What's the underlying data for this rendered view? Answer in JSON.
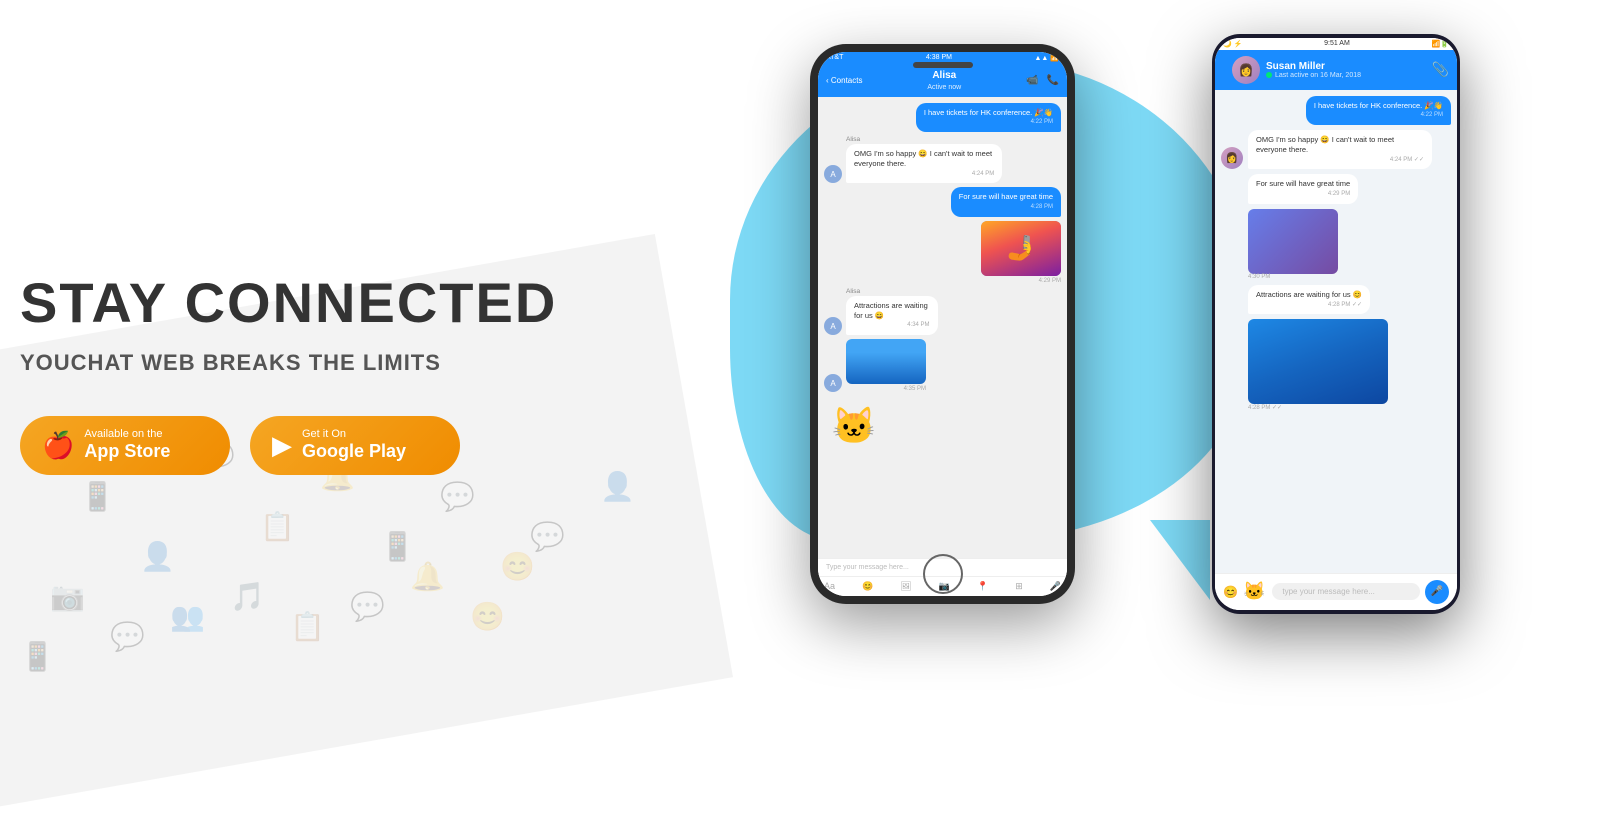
{
  "page": {
    "bg_color": "#ffffff"
  },
  "left": {
    "title": "STAY CONNECTED",
    "subtitle": "YOUCHAT WEB BREAKS THE LIMITS",
    "app_store": {
      "small": "Available on the",
      "big": "App Store",
      "icon": "🍎"
    },
    "google_play": {
      "small": "Get it On",
      "big": "Google Play",
      "icon": "▶"
    }
  },
  "phone1": {
    "carrier": "AT&T",
    "time": "4:38 PM",
    "contact_back": "Contacts",
    "chat_name": "Alisa",
    "chat_status": "Active now",
    "messages": [
      {
        "type": "sent",
        "text": "I have tickets for HK conference. 🎉👋",
        "time": "4:22 PM"
      },
      {
        "type": "received",
        "sender": "Alisa",
        "text": "OMG I'm so happy 😄 I can't wait to meet everyone there.",
        "time": "4:24 PM"
      },
      {
        "type": "sent",
        "text": "For sure will have great time",
        "time": "4:28 PM"
      },
      {
        "type": "sent-image",
        "time": "4:29 PM"
      },
      {
        "type": "received",
        "sender": "Alisa",
        "text": "Attractions are waiting for us 😄",
        "time": "4:34 PM"
      },
      {
        "type": "received-image",
        "time": "4:35 PM"
      },
      {
        "type": "sticker"
      }
    ],
    "input_placeholder": "Type your message here..."
  },
  "phone2": {
    "time": "9:51 AM",
    "chat_name": "Susan Miller",
    "chat_status": "Last active on 16 Mar, 2018",
    "messages": [
      {
        "type": "sent",
        "text": "I have tickets for HK conference. 🎉👋",
        "time": "4:22 PM"
      },
      {
        "type": "received",
        "text": "OMG I'm so happy 😄 I can't wait to meet everyone there.",
        "time": "4:24 PM"
      },
      {
        "type": "received",
        "text": "For sure will have great time",
        "time": "4:29 PM"
      },
      {
        "type": "received-image",
        "time": "4:30 PM"
      },
      {
        "type": "received",
        "text": "Attractions are waiting for us 😊",
        "time": "4:28 PM"
      },
      {
        "type": "received-image-2",
        "time": "4:28 PM"
      }
    ],
    "input_placeholder": "type your message here..."
  }
}
